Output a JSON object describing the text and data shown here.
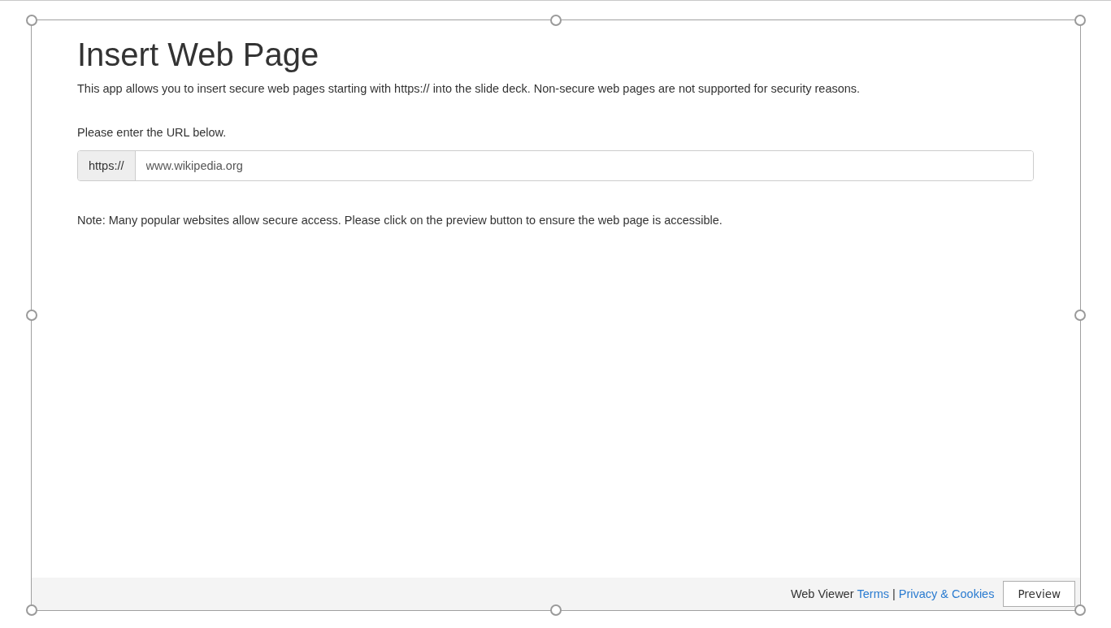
{
  "title": "Insert Web Page",
  "description": "This app allows you to insert secure web pages starting with https:// into the slide deck. Non-secure web pages are not supported for security reasons.",
  "url_prompt": "Please enter the URL below.",
  "url_field": {
    "prefix": "https://",
    "value": "www.wikipedia.org"
  },
  "note": "Note: Many popular websites allow secure access. Please click on the preview button to ensure the web page is accessible.",
  "footer": {
    "label": "Web Viewer",
    "links": [
      {
        "label": "Terms"
      },
      {
        "label": "Privacy & Cookies"
      }
    ],
    "separator": "|",
    "button": "Preview"
  }
}
